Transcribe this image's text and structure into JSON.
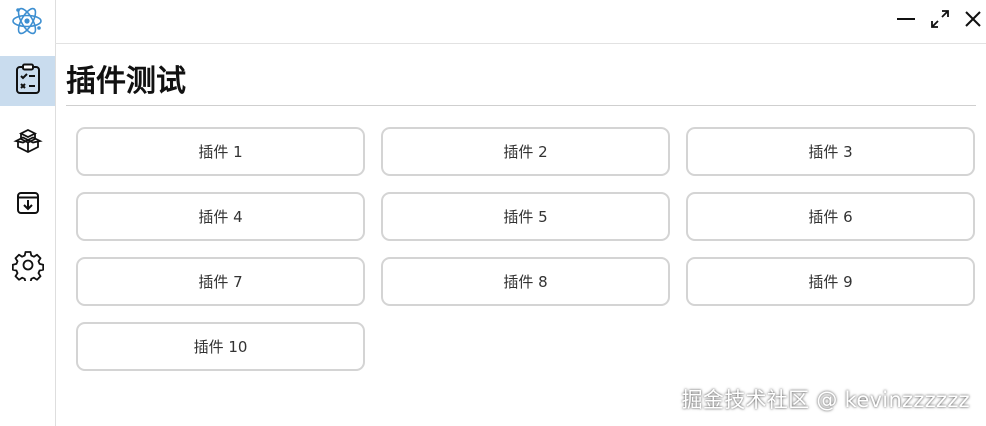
{
  "window": {
    "controls": [
      {
        "name": "minimize-icon"
      },
      {
        "name": "maximize-icon"
      },
      {
        "name": "close-icon"
      }
    ]
  },
  "sidebar": {
    "logo": "atom-logo-icon",
    "items": [
      {
        "icon": "clipboard-checklist-icon",
        "active": true
      },
      {
        "icon": "package-icon",
        "active": false
      },
      {
        "icon": "download-box-icon",
        "active": false
      },
      {
        "icon": "gear-icon",
        "active": false
      }
    ]
  },
  "main": {
    "title": "插件测试",
    "plugins": [
      {
        "label": "插件 1"
      },
      {
        "label": "插件 2"
      },
      {
        "label": "插件 3"
      },
      {
        "label": "插件 4"
      },
      {
        "label": "插件 5"
      },
      {
        "label": "插件 6"
      },
      {
        "label": "插件 7"
      },
      {
        "label": "插件 8"
      },
      {
        "label": "插件 9"
      },
      {
        "label": "插件 10"
      }
    ]
  },
  "watermark": "掘金技术社区 @ kevinzzzzzz",
  "colors": {
    "active_nav_bg": "#c9dcee",
    "logo_accent": "#3d8fd1",
    "button_border": "#d4d4d4"
  }
}
